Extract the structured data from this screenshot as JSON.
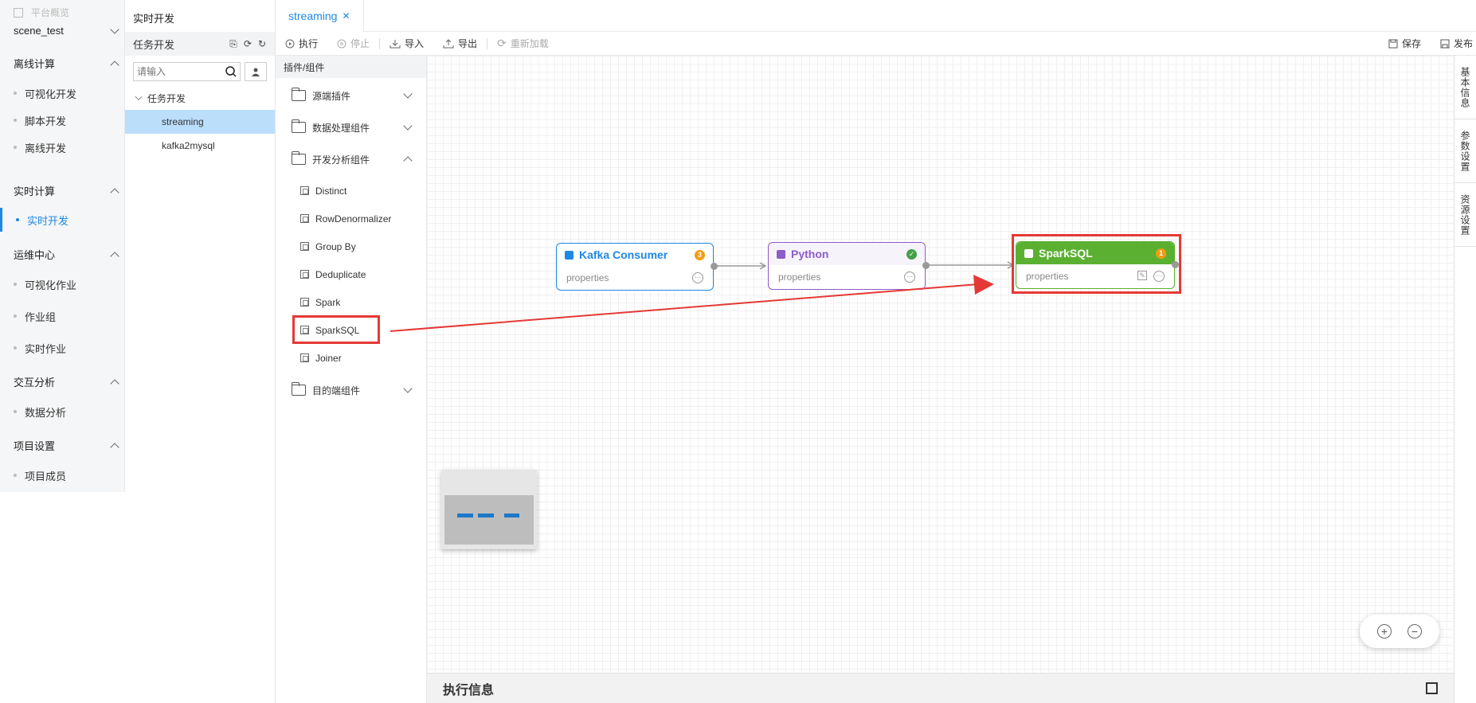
{
  "nav": {
    "top_label": "平台概览",
    "project": "scene_test",
    "groups": [
      {
        "label": "离线计算",
        "items": [
          "可视化开发",
          "脚本开发",
          "离线开发"
        ]
      },
      {
        "label": "实时计算",
        "items": [
          "实时开发"
        ]
      },
      {
        "label": "运维中心",
        "items": [
          "可视化作业",
          "作业组",
          "实时作业"
        ]
      },
      {
        "label": "交互分析",
        "items": [
          "数据分析"
        ]
      },
      {
        "label": "项目设置",
        "items": [
          "项目成员"
        ]
      }
    ],
    "active_item": "实时开发"
  },
  "tree": {
    "header": "实时开发",
    "section": "任务开发",
    "search_placeholder": "请输入",
    "root": "任务开发",
    "leaves": [
      "streaming",
      "kafka2mysql"
    ]
  },
  "tab": {
    "label": "streaming",
    "close": "✕"
  },
  "toolbar": {
    "run": "执行",
    "stop": "停止",
    "import": "导入",
    "export": "导出",
    "reload": "重新加载",
    "save": "保存",
    "publish": "发布"
  },
  "palette": {
    "header": "插件/组件",
    "folders": [
      "源端插件",
      "数据处理组件",
      "开发分析组件",
      "目的端组件"
    ],
    "components": [
      "Distinct",
      "RowDenormalizer",
      "Group By",
      "Deduplicate",
      "Spark",
      "SparkSQL",
      "Joiner"
    ]
  },
  "nodes": [
    {
      "title": "Kafka Consumer",
      "badge": "3",
      "body": "properties",
      "color": "#1e88e5",
      "badge_color": "#f39c12"
    },
    {
      "title": "Python",
      "badge": "✓",
      "body": "properties",
      "color": "#8e5cc7",
      "badge_color": "#43a047"
    },
    {
      "title": "SparkSQL",
      "badge": "1",
      "body": "properties",
      "color": "#5cb031",
      "badge_color": "#f39c12"
    }
  ],
  "exec_panel": {
    "title": "执行信息"
  },
  "right_tabs": [
    "基本信息",
    "参数设置",
    "资源设置"
  ],
  "icons": {
    "more": "⋯",
    "edit": "✎",
    "zoom_in": "+",
    "zoom_out": "−"
  }
}
